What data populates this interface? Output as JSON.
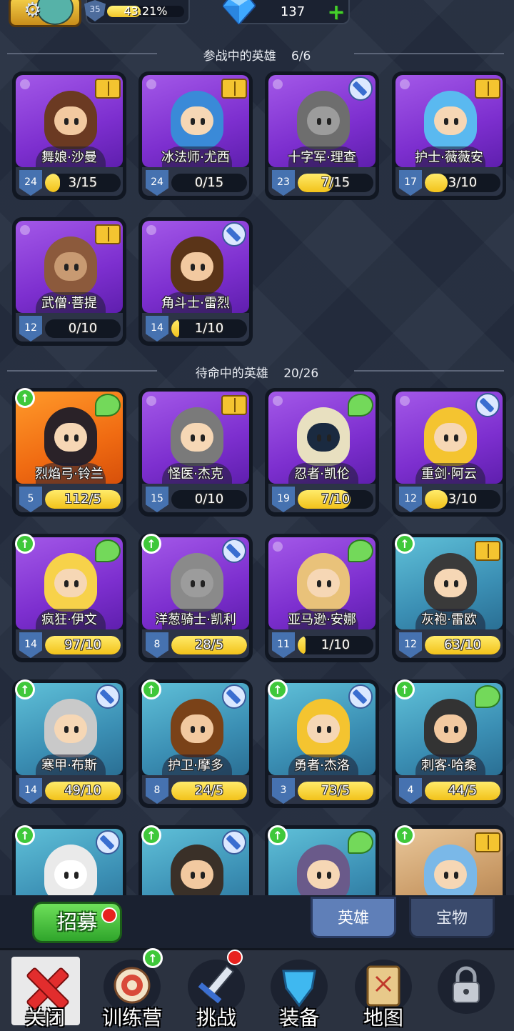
{
  "top": {
    "player_level": "35",
    "exp_percent": "43.21%",
    "exp_fraction": 0.4321,
    "gems": "137"
  },
  "sections": {
    "active": {
      "title": "参战中的英雄",
      "count": "6/6"
    },
    "reserve": {
      "title": "待命中的英雄",
      "count": "20/26"
    }
  },
  "active_heroes": [
    {
      "name": "舞娘·沙曼",
      "level": "24",
      "progress": "3/15",
      "fill": 0.2,
      "bg": "purple",
      "cls": "book",
      "hair": "#6b3a22",
      "skin": "#f2c9a0"
    },
    {
      "name": "冰法师·尤西",
      "level": "24",
      "progress": "0/15",
      "fill": 0.0,
      "bg": "purple",
      "cls": "book",
      "hair": "#3a8ad8",
      "skin": "#f6d7b5"
    },
    {
      "name": "十字军·理查",
      "level": "23",
      "progress": "7/15",
      "fill": 0.47,
      "bg": "purple",
      "cls": "sword",
      "hair": "#6e6e6e",
      "skin": "#9c9c9c"
    },
    {
      "name": "护士·薇薇安",
      "level": "17",
      "progress": "3/10",
      "fill": 0.3,
      "bg": "purple",
      "cls": "book",
      "hair": "#5ab9f0",
      "skin": "#f6d7b5"
    },
    {
      "name": "武僧·菩提",
      "level": "12",
      "progress": "0/10",
      "fill": 0.0,
      "bg": "purple",
      "cls": "book",
      "hair": "#8c5a3c",
      "skin": "#c89a72"
    },
    {
      "name": "角斗士·雷烈",
      "level": "14",
      "progress": "1/10",
      "fill": 0.1,
      "bg": "purple",
      "cls": "sword",
      "hair": "#5a3418",
      "skin": "#f2c9a0"
    }
  ],
  "reserve_heroes": [
    {
      "name": "烈焰弓·铃兰",
      "level": "5",
      "progress": "112/5",
      "fill": 1.0,
      "bg": "orange",
      "cls": "wing",
      "upgrade": true,
      "hair": "#2a2228",
      "skin": "#f6d7b5"
    },
    {
      "name": "怪医·杰克",
      "level": "15",
      "progress": "0/10",
      "fill": 0.0,
      "bg": "purple",
      "cls": "book",
      "upgrade": false,
      "hair": "#7a7a7a",
      "skin": "#f6d7b5"
    },
    {
      "name": "忍者·凯伦",
      "level": "19",
      "progress": "7/10",
      "fill": 0.7,
      "bg": "purple",
      "cls": "wing",
      "upgrade": false,
      "hair": "#e8e0c0",
      "skin": "#1a2a40"
    },
    {
      "name": "重剑·阿云",
      "level": "12",
      "progress": "3/10",
      "fill": 0.3,
      "bg": "purple",
      "cls": "sword",
      "upgrade": false,
      "hair": "#f4c430",
      "skin": "#f6d7b5"
    },
    {
      "name": "疯狂·伊文",
      "level": "14",
      "progress": "97/10",
      "fill": 1.0,
      "bg": "purple",
      "cls": "wing",
      "upgrade": true,
      "hair": "#f7d24a",
      "skin": "#f6d7b5"
    },
    {
      "name": "洋葱骑士·凯利",
      "level": "8",
      "progress": "28/5",
      "fill": 1.0,
      "bg": "purple",
      "cls": "sword",
      "upgrade": true,
      "hair": "#8a8a8a",
      "skin": "#9c9c9c"
    },
    {
      "name": "亚马逊·安娜",
      "level": "11",
      "progress": "1/10",
      "fill": 0.1,
      "bg": "purple",
      "cls": "wing",
      "upgrade": false,
      "hair": "#e9c27a",
      "skin": "#f6d7b5"
    },
    {
      "name": "灰袍·雷欧",
      "level": "12",
      "progress": "63/10",
      "fill": 1.0,
      "bg": "blue",
      "cls": "book",
      "upgrade": true,
      "hair": "#3a3a3a",
      "skin": "#f6d7b5"
    },
    {
      "name": "寒甲·布斯",
      "level": "14",
      "progress": "49/10",
      "fill": 1.0,
      "bg": "blue",
      "cls": "sword",
      "upgrade": true,
      "hair": "#c9c9c9",
      "skin": "#f6d7b5"
    },
    {
      "name": "护卫·摩多",
      "level": "8",
      "progress": "24/5",
      "fill": 1.0,
      "bg": "blue",
      "cls": "sword",
      "upgrade": true,
      "hair": "#7a4218",
      "skin": "#f2c9a0"
    },
    {
      "name": "勇者·杰洛",
      "level": "3",
      "progress": "73/5",
      "fill": 1.0,
      "bg": "blue",
      "cls": "sword",
      "upgrade": true,
      "hair": "#f4c430",
      "skin": "#f6d7b5"
    },
    {
      "name": "刺客·哈桑",
      "level": "4",
      "progress": "44/5",
      "fill": 1.0,
      "bg": "blue",
      "cls": "wing",
      "upgrade": true,
      "hair": "#333333",
      "skin": "#f2c9a0"
    },
    {
      "name": "",
      "level": "",
      "progress": "",
      "fill": 0,
      "bg": "blue",
      "cls": "sword",
      "upgrade": true,
      "hair": "#eaeaea",
      "skin": "#ffffff"
    },
    {
      "name": "",
      "level": "",
      "progress": "",
      "fill": 0,
      "bg": "blue",
      "cls": "sword",
      "upgrade": true,
      "hair": "#3a3028",
      "skin": "#f2c9a0"
    },
    {
      "name": "",
      "level": "",
      "progress": "",
      "fill": 0,
      "bg": "blue",
      "cls": "wing",
      "upgrade": true,
      "hair": "#6a5a8a",
      "skin": "#f6d7b5"
    },
    {
      "name": "",
      "level": "",
      "progress": "",
      "fill": 0,
      "bg": "tan",
      "cls": "book",
      "upgrade": true,
      "hair": "#7ab8e8",
      "skin": "#f6d7b5"
    }
  ],
  "controls": {
    "recruit_label": "招募",
    "tab_heroes": "英雄",
    "tab_treasure": "宝物"
  },
  "nav": [
    {
      "label": "关闭",
      "icon": "close-icon"
    },
    {
      "label": "训练营",
      "icon": "training-target-icon"
    },
    {
      "label": "挑战",
      "icon": "sword-icon"
    },
    {
      "label": "装备",
      "icon": "armor-icon"
    },
    {
      "label": "地图",
      "icon": "map-icon"
    },
    {
      "label": "",
      "icon": "lock-icon"
    }
  ]
}
